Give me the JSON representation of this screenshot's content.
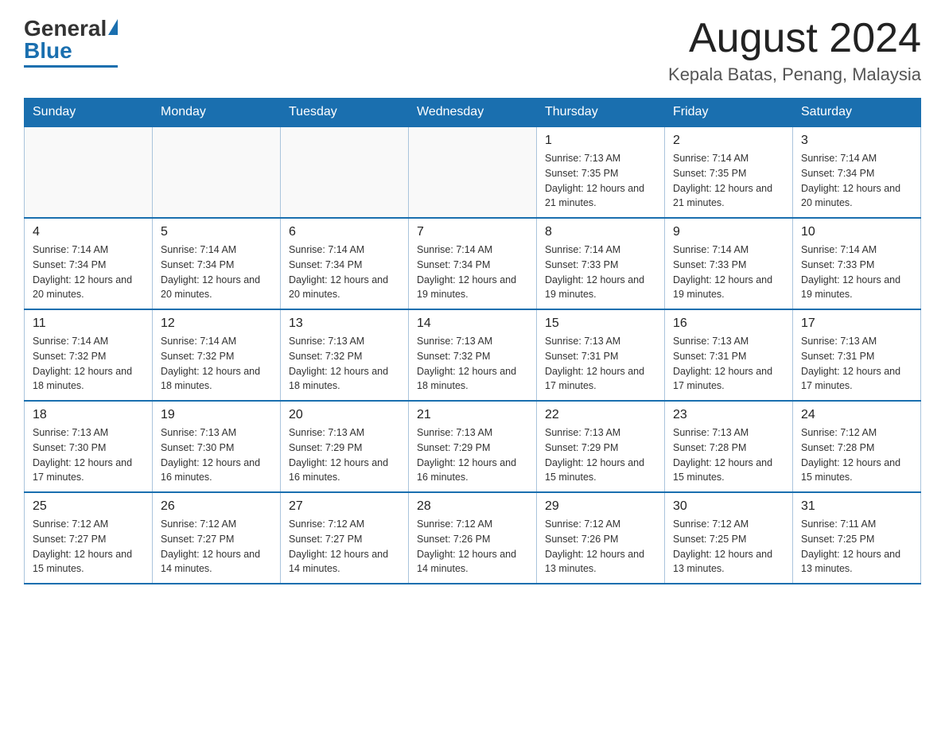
{
  "logo": {
    "general": "General",
    "blue": "Blue"
  },
  "title": "August 2024",
  "subtitle": "Kepala Batas, Penang, Malaysia",
  "days_of_week": [
    "Sunday",
    "Monday",
    "Tuesday",
    "Wednesday",
    "Thursday",
    "Friday",
    "Saturday"
  ],
  "weeks": [
    [
      {
        "day": "",
        "info": ""
      },
      {
        "day": "",
        "info": ""
      },
      {
        "day": "",
        "info": ""
      },
      {
        "day": "",
        "info": ""
      },
      {
        "day": "1",
        "info": "Sunrise: 7:13 AM\nSunset: 7:35 PM\nDaylight: 12 hours and 21 minutes."
      },
      {
        "day": "2",
        "info": "Sunrise: 7:14 AM\nSunset: 7:35 PM\nDaylight: 12 hours and 21 minutes."
      },
      {
        "day": "3",
        "info": "Sunrise: 7:14 AM\nSunset: 7:34 PM\nDaylight: 12 hours and 20 minutes."
      }
    ],
    [
      {
        "day": "4",
        "info": "Sunrise: 7:14 AM\nSunset: 7:34 PM\nDaylight: 12 hours and 20 minutes."
      },
      {
        "day": "5",
        "info": "Sunrise: 7:14 AM\nSunset: 7:34 PM\nDaylight: 12 hours and 20 minutes."
      },
      {
        "day": "6",
        "info": "Sunrise: 7:14 AM\nSunset: 7:34 PM\nDaylight: 12 hours and 20 minutes."
      },
      {
        "day": "7",
        "info": "Sunrise: 7:14 AM\nSunset: 7:34 PM\nDaylight: 12 hours and 19 minutes."
      },
      {
        "day": "8",
        "info": "Sunrise: 7:14 AM\nSunset: 7:33 PM\nDaylight: 12 hours and 19 minutes."
      },
      {
        "day": "9",
        "info": "Sunrise: 7:14 AM\nSunset: 7:33 PM\nDaylight: 12 hours and 19 minutes."
      },
      {
        "day": "10",
        "info": "Sunrise: 7:14 AM\nSunset: 7:33 PM\nDaylight: 12 hours and 19 minutes."
      }
    ],
    [
      {
        "day": "11",
        "info": "Sunrise: 7:14 AM\nSunset: 7:32 PM\nDaylight: 12 hours and 18 minutes."
      },
      {
        "day": "12",
        "info": "Sunrise: 7:14 AM\nSunset: 7:32 PM\nDaylight: 12 hours and 18 minutes."
      },
      {
        "day": "13",
        "info": "Sunrise: 7:13 AM\nSunset: 7:32 PM\nDaylight: 12 hours and 18 minutes."
      },
      {
        "day": "14",
        "info": "Sunrise: 7:13 AM\nSunset: 7:32 PM\nDaylight: 12 hours and 18 minutes."
      },
      {
        "day": "15",
        "info": "Sunrise: 7:13 AM\nSunset: 7:31 PM\nDaylight: 12 hours and 17 minutes."
      },
      {
        "day": "16",
        "info": "Sunrise: 7:13 AM\nSunset: 7:31 PM\nDaylight: 12 hours and 17 minutes."
      },
      {
        "day": "17",
        "info": "Sunrise: 7:13 AM\nSunset: 7:31 PM\nDaylight: 12 hours and 17 minutes."
      }
    ],
    [
      {
        "day": "18",
        "info": "Sunrise: 7:13 AM\nSunset: 7:30 PM\nDaylight: 12 hours and 17 minutes."
      },
      {
        "day": "19",
        "info": "Sunrise: 7:13 AM\nSunset: 7:30 PM\nDaylight: 12 hours and 16 minutes."
      },
      {
        "day": "20",
        "info": "Sunrise: 7:13 AM\nSunset: 7:29 PM\nDaylight: 12 hours and 16 minutes."
      },
      {
        "day": "21",
        "info": "Sunrise: 7:13 AM\nSunset: 7:29 PM\nDaylight: 12 hours and 16 minutes."
      },
      {
        "day": "22",
        "info": "Sunrise: 7:13 AM\nSunset: 7:29 PM\nDaylight: 12 hours and 15 minutes."
      },
      {
        "day": "23",
        "info": "Sunrise: 7:13 AM\nSunset: 7:28 PM\nDaylight: 12 hours and 15 minutes."
      },
      {
        "day": "24",
        "info": "Sunrise: 7:12 AM\nSunset: 7:28 PM\nDaylight: 12 hours and 15 minutes."
      }
    ],
    [
      {
        "day": "25",
        "info": "Sunrise: 7:12 AM\nSunset: 7:27 PM\nDaylight: 12 hours and 15 minutes."
      },
      {
        "day": "26",
        "info": "Sunrise: 7:12 AM\nSunset: 7:27 PM\nDaylight: 12 hours and 14 minutes."
      },
      {
        "day": "27",
        "info": "Sunrise: 7:12 AM\nSunset: 7:27 PM\nDaylight: 12 hours and 14 minutes."
      },
      {
        "day": "28",
        "info": "Sunrise: 7:12 AM\nSunset: 7:26 PM\nDaylight: 12 hours and 14 minutes."
      },
      {
        "day": "29",
        "info": "Sunrise: 7:12 AM\nSunset: 7:26 PM\nDaylight: 12 hours and 13 minutes."
      },
      {
        "day": "30",
        "info": "Sunrise: 7:12 AM\nSunset: 7:25 PM\nDaylight: 12 hours and 13 minutes."
      },
      {
        "day": "31",
        "info": "Sunrise: 7:11 AM\nSunset: 7:25 PM\nDaylight: 12 hours and 13 minutes."
      }
    ]
  ]
}
